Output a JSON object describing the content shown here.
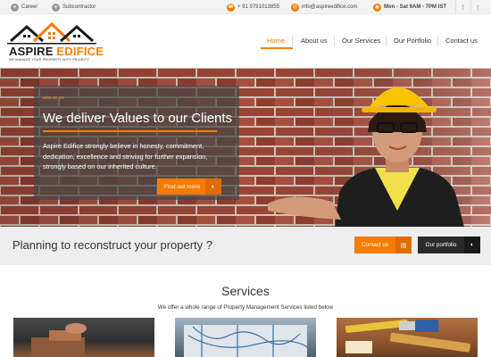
{
  "topbar": {
    "career": "Career",
    "subcontractor": "Subcontractor",
    "phone": "+ 91 9791013855",
    "email": "info@aspireedifice.com",
    "hours": "Mon - Sat 9AM - 7PM IST",
    "social": [
      "f",
      "t"
    ]
  },
  "logo": {
    "name_part1": "ASPIRE",
    "name_part2": "EDIFICE",
    "tagline": "WE MANAGE YOUR PROPERTY WITH PRIORITY"
  },
  "nav": {
    "items": [
      "Home",
      "About us",
      "Our Services",
      "Our Portfolio",
      "Contact us"
    ],
    "active": "Home"
  },
  "hero": {
    "kicker": "Who we are",
    "title": "We deliver Values to our Clients",
    "text": "Aspire Edifice strongly believe in honesty, commitment, dedication, excellence and striving for further expansion, strongly based on our inherited culture.",
    "button": "Find out more"
  },
  "cta": {
    "text": "Planning to reconstruct your property ?",
    "contact_button": "Contact us",
    "portfolio_button": "Our portfolio"
  },
  "services": {
    "title": "Services",
    "subtitle": "We offer a whole range of Property Management Services listed below"
  },
  "colors": {
    "accent": "#f57c00",
    "dark": "#2b2b2b",
    "strip": "#eeeeee"
  }
}
